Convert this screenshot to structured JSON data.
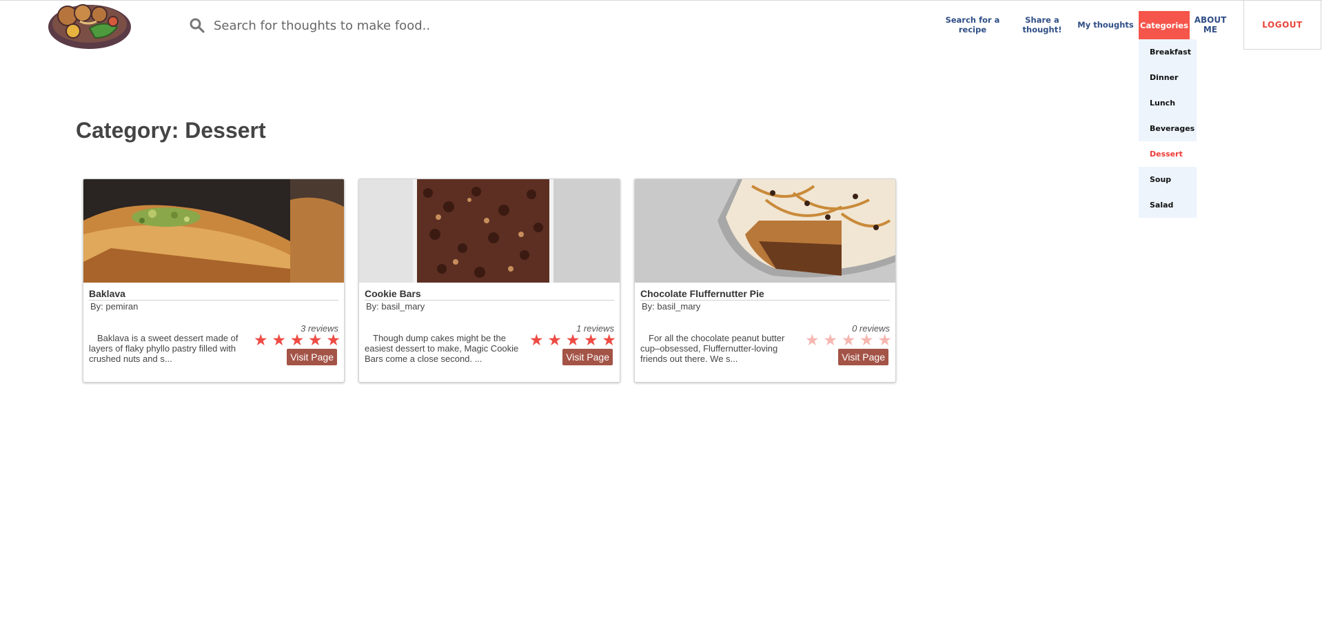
{
  "header": {
    "search_placeholder": "Search for thoughts to make food..",
    "nav": {
      "search_recipe": "Search for a recipe",
      "share_thought": "Share a thought!",
      "my_thoughts": "My thoughts",
      "categories": "Categories",
      "about_me": "ABOUT ME",
      "logout": "LOGOUT"
    }
  },
  "dropdown": {
    "items": [
      "Breakfast",
      "Dinner",
      "Lunch",
      "Beverages",
      "Dessert",
      "Soup",
      "Salad"
    ],
    "active": "Dessert"
  },
  "page": {
    "title": "Category: Dessert"
  },
  "cards": [
    {
      "name": "Baklava",
      "author": "By: pemiran",
      "reviews": "3 reviews",
      "description": "Baklava is a sweet dessert made of layers of flaky phyllo pastry filled with crushed nuts and s...",
      "rating": 5,
      "visit_label": "Visit Page"
    },
    {
      "name": "Cookie Bars",
      "author": "By: basil_mary",
      "reviews": "1 reviews",
      "description": "Though dump cakes might be the easiest dessert to make, Magic Cookie Bars come a close second. ...",
      "rating": 5,
      "visit_label": "Visit Page"
    },
    {
      "name": "Chocolate Fluffernutter Pie",
      "author": "By: basil_mary",
      "reviews": "0 reviews",
      "description": "For all the chocolate peanut butter cup–obsessed, Fluffernutter-loving friends out there. We s...",
      "rating": 0,
      "visit_label": "Visit Page"
    }
  ],
  "colors": {
    "accent": "#f5554a",
    "nav_text": "#2f4e86",
    "visit_button": "#a35447",
    "star_filled": "#ee4b45",
    "star_empty": "#f6b7b1",
    "dropdown_bg": "#edf4fc"
  },
  "icons": [
    "logo-food-bowl",
    "search-icon",
    "star-icon"
  ]
}
